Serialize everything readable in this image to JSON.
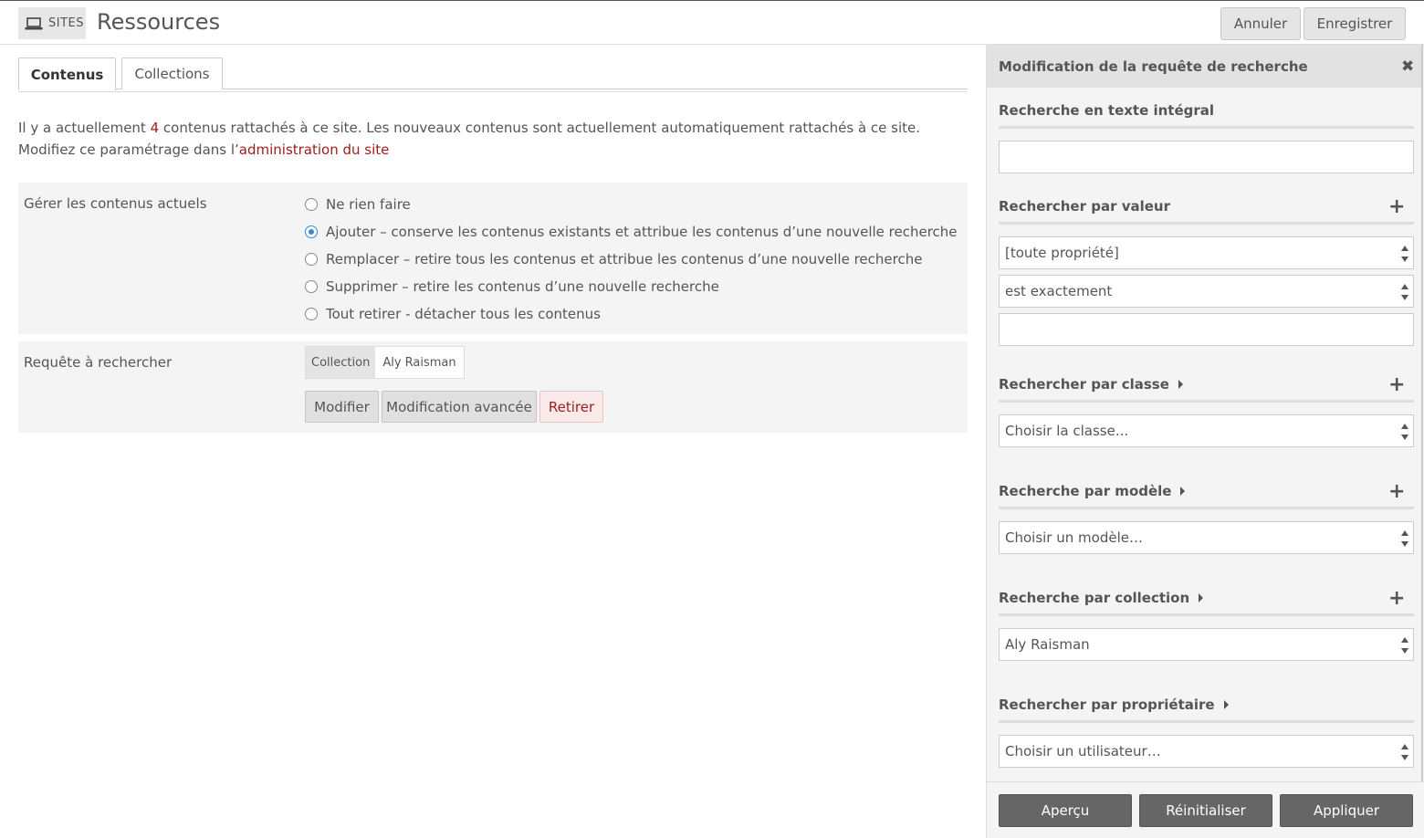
{
  "header": {
    "sites_label": "SITES",
    "title": "Ressources",
    "cancel_label": "Annuler",
    "save_label": "Enregistrer"
  },
  "tabs": [
    {
      "label": "Contenus",
      "active": true
    },
    {
      "label": "Collections",
      "active": false
    }
  ],
  "info": {
    "text_1": "Il y a actuellement ",
    "count": "4",
    "text_2": " contenus rattachés à ce site. Les nouveaux contenus sont actuellement automatiquement rattachés à ce site. Modifiez ce paramétrage dans l’",
    "link": "administration du site"
  },
  "manage": {
    "label": "Gérer les contenus actuels",
    "options": [
      {
        "label": "Ne rien faire",
        "checked": false
      },
      {
        "label": "Ajouter – conserve les contenus existants et attribue les contenus d’une nouvelle recherche",
        "checked": true
      },
      {
        "label": "Remplacer – retire tous les contenus et attribue les contenus d’une nouvelle recherche",
        "checked": false
      },
      {
        "label": "Supprimer – retire les contenus d’une nouvelle recherche",
        "checked": false
      },
      {
        "label": "Tout retirer - détacher tous les contenus",
        "checked": false
      }
    ]
  },
  "query": {
    "label": "Requête à rechercher",
    "tag_key": "Collection",
    "tag_value": "Aly Raisman",
    "modify_label": "Modifier",
    "advanced_label": "Modification avancée",
    "remove_label": "Retirer"
  },
  "sidebar": {
    "title": "Modification de la requête de recherche",
    "fulltext": {
      "title": "Recherche en texte intégral",
      "value": ""
    },
    "by_value": {
      "title": "Rechercher par valeur",
      "property": "[toute propriété]",
      "operator": "est exactement",
      "value": ""
    },
    "by_class": {
      "title": "Rechercher par classe",
      "selected": "Choisir la classe..."
    },
    "by_template": {
      "title": "Recherche par modèle",
      "selected": "Choisir un modèle…"
    },
    "by_collection": {
      "title": "Recherche par collection",
      "selected": "Aly Raisman"
    },
    "by_owner": {
      "title": "Rechercher par propriétaire",
      "selected": "Choisir un utilisateur…"
    },
    "preview_label": "Aperçu",
    "reset_label": "Réinitialiser",
    "apply_label": "Appliquer"
  },
  "colors": {
    "accent": "#9c1c1c",
    "radio_checked": "#3b88d4",
    "footer_button": "#666666"
  }
}
